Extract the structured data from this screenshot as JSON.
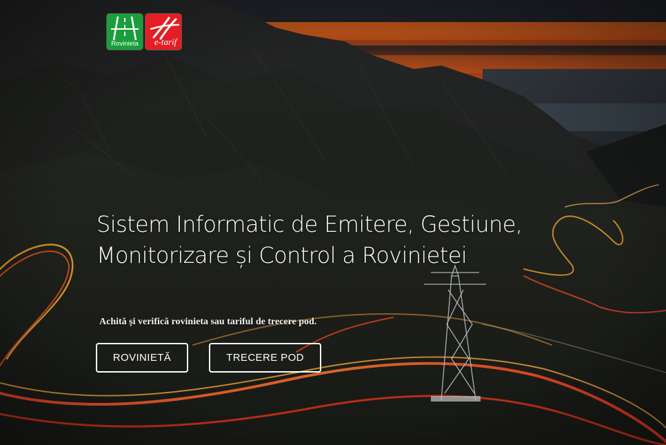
{
  "logos": {
    "rovinieta": {
      "label": "Rovinieta",
      "color": "#1a9e3c"
    },
    "etarif": {
      "label": "e-tarif",
      "color": "#e31e24"
    }
  },
  "hero": {
    "headline_line1": "Sistem Informatic de Emitere, Gestiune,",
    "headline_line2": "Monitorizare și Control a Rovinietei",
    "subtitle": "Achită și verifică rovinieta sau tariful de trecere pod."
  },
  "buttons": {
    "rovinieta": "ROVINIETĂ",
    "trecere_pod": "TRECERE POD"
  }
}
